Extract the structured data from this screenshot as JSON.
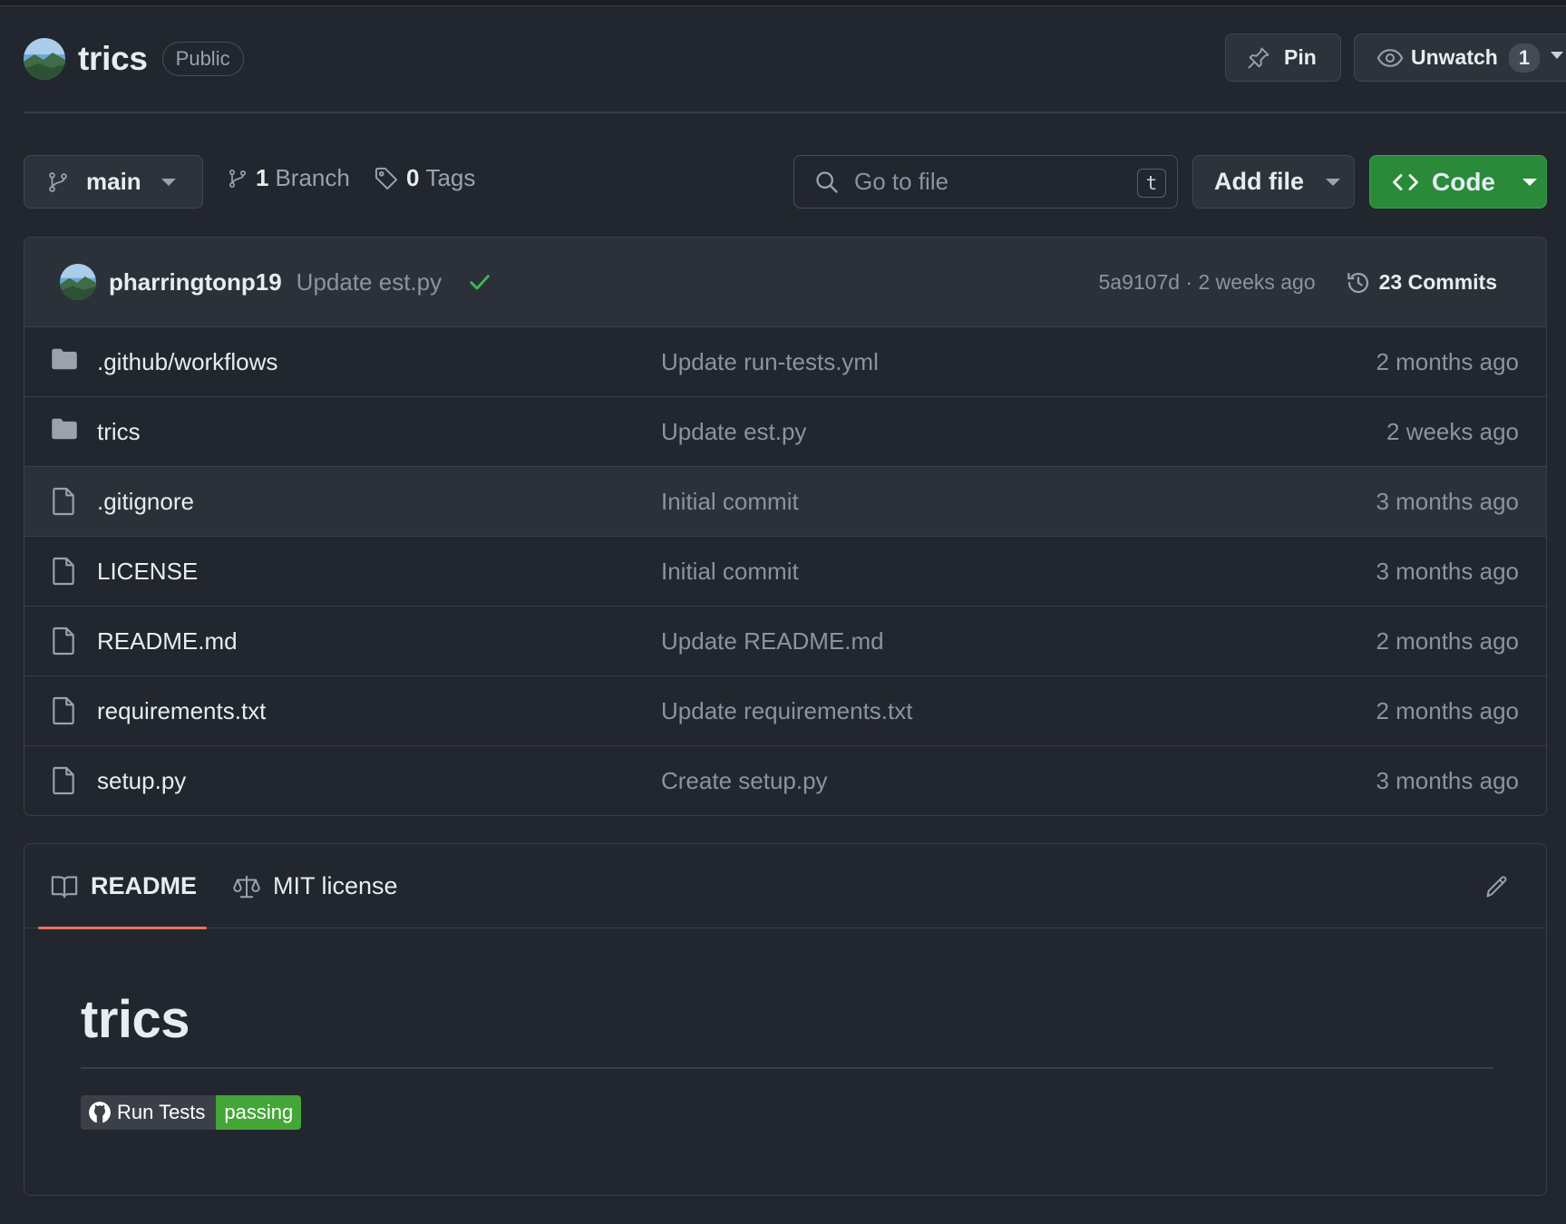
{
  "repo": {
    "name": "trics",
    "visibility": "Public",
    "pin_label": "Pin",
    "watch_label": "Unwatch",
    "watch_count": "1"
  },
  "toolbar": {
    "branch": "main",
    "branch_count": "1",
    "branch_label": "Branch",
    "tag_count": "0",
    "tag_label": "Tags",
    "search_placeholder": "Go to file",
    "search_shortcut": "t",
    "add_file_label": "Add file",
    "code_label": "Code"
  },
  "latest_commit": {
    "author": "pharringtonp19",
    "message": "Update est.py",
    "status": "success",
    "sha_time": "5a9107d · 2 weeks ago",
    "commits_label": "23 Commits"
  },
  "files": [
    {
      "type": "folder",
      "name": ".github/workflows",
      "message": "Update run-tests.yml",
      "age": "2 months ago"
    },
    {
      "type": "folder",
      "name": "trics",
      "message": "Update est.py",
      "age": "2 weeks ago"
    },
    {
      "type": "file",
      "name": ".gitignore",
      "message": "Initial commit",
      "age": "3 months ago"
    },
    {
      "type": "file",
      "name": "LICENSE",
      "message": "Initial commit",
      "age": "3 months ago"
    },
    {
      "type": "file",
      "name": "README.md",
      "message": "Update README.md",
      "age": "2 months ago"
    },
    {
      "type": "file",
      "name": "requirements.txt",
      "message": "Update requirements.txt",
      "age": "2 months ago"
    },
    {
      "type": "file",
      "name": "setup.py",
      "message": "Create setup.py",
      "age": "3 months ago"
    }
  ],
  "readme": {
    "tab_readme": "README",
    "tab_license": "MIT license",
    "title": "trics",
    "badge_label": "Run Tests",
    "badge_status": "passing"
  },
  "colors": {
    "background": "#22262e",
    "code_button": "#2a8a3a",
    "badge_passing": "#44a637",
    "active_tab_underline": "#e8735c",
    "check": "#3fb950"
  }
}
